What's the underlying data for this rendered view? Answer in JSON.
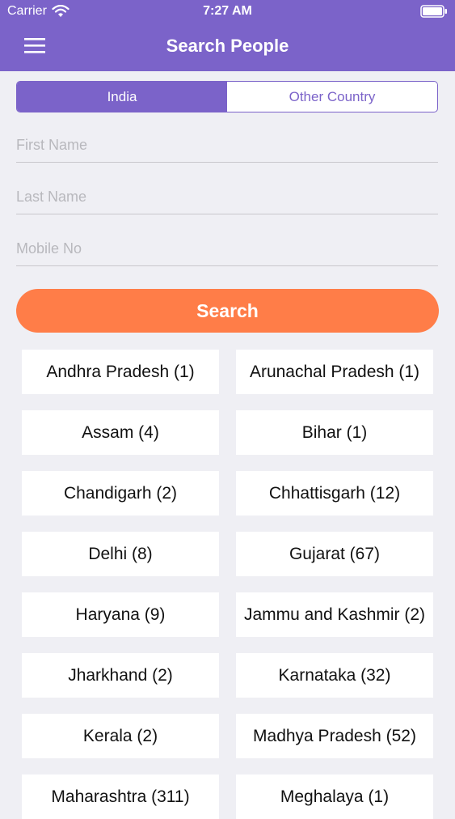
{
  "status_bar": {
    "carrier": "Carrier",
    "time": "7:27 AM"
  },
  "nav": {
    "title": "Search People",
    "menu_icon": "hamburger-menu-icon"
  },
  "tabs": [
    {
      "label": "India",
      "active": true
    },
    {
      "label": "Other Country",
      "active": false
    }
  ],
  "form": {
    "first_name_placeholder": "First Name",
    "last_name_placeholder": "Last Name",
    "mobile_placeholder": "Mobile No",
    "search_label": "Search"
  },
  "states": [
    "Andhra Pradesh (1)",
    "Arunachal Pradesh (1)",
    "Assam (4)",
    "Bihar (1)",
    "Chandigarh (2)",
    "Chhattisgarh (12)",
    "Delhi (8)",
    "Gujarat (67)",
    "Haryana (9)",
    "Jammu and Kashmir (2)",
    "Jharkhand (2)",
    "Karnataka (32)",
    "Kerala (2)",
    "Madhya Pradesh (52)",
    "Maharashtra (311)",
    "Meghalaya (1)"
  ],
  "colors": {
    "primary": "#7b63c9",
    "accent": "#ff7d48",
    "background": "#efeff4"
  }
}
